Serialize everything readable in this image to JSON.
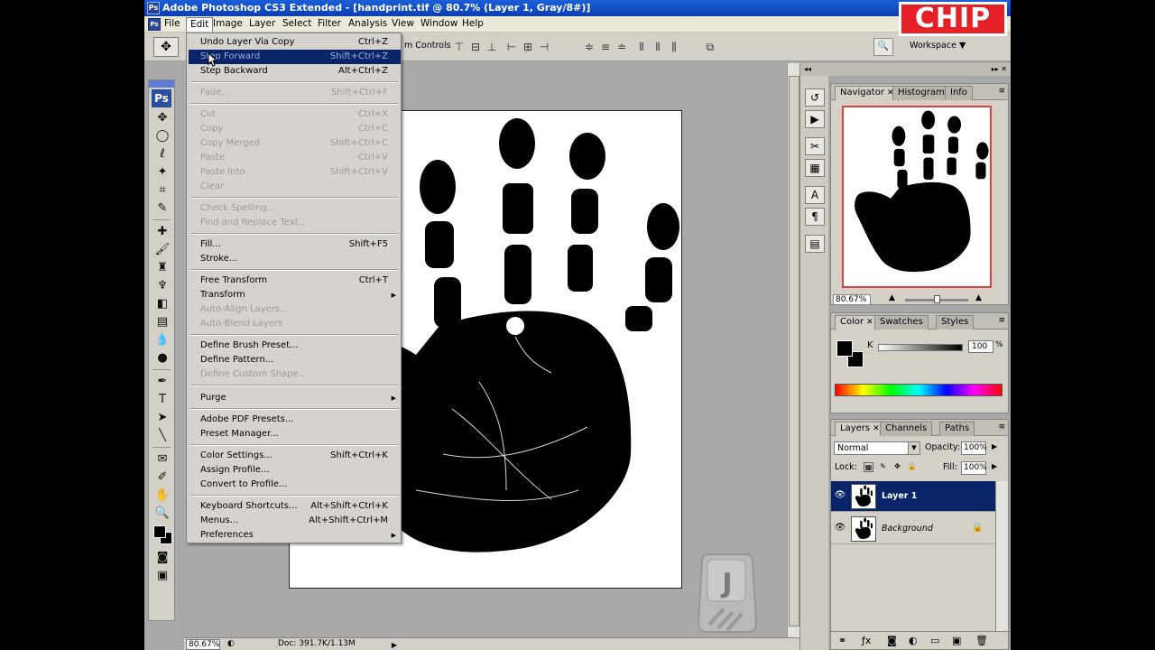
{
  "window": {
    "title": "Adobe Photoshop CS3 Extended - [handprint.tif @ 80.7% (Layer 1, Gray/8#)]",
    "app_icon": "Ps"
  },
  "menubar": {
    "items": [
      "File",
      "Edit",
      "Image",
      "Layer",
      "Select",
      "Filter",
      "Analysis",
      "View",
      "Window",
      "Help"
    ],
    "active": "Edit"
  },
  "options_bar": {
    "transform_label": "m Controls",
    "workspace_label": "Workspace ▼"
  },
  "toolbox": {
    "logo": "Ps"
  },
  "edit_menu": {
    "items": [
      {
        "label": "Undo Layer Via Copy",
        "shortcut": "Ctrl+Z"
      },
      {
        "label": "Step Forward",
        "shortcut": "Shift+Ctrl+Z"
      },
      {
        "label": "Step Backward",
        "shortcut": "Alt+Ctrl+Z"
      },
      {
        "label": "Fade...",
        "shortcut": "Shift+Ctrl+F"
      },
      {
        "label": "Cut",
        "shortcut": "Ctrl+X"
      },
      {
        "label": "Copy",
        "shortcut": "Ctrl+C"
      },
      {
        "label": "Copy Merged",
        "shortcut": "Shift+Ctrl+C"
      },
      {
        "label": "Paste",
        "shortcut": "Ctrl+V"
      },
      {
        "label": "Paste Into",
        "shortcut": "Shift+Ctrl+V"
      },
      {
        "label": "Clear",
        "shortcut": ""
      },
      {
        "label": "Check Spelling...",
        "shortcut": ""
      },
      {
        "label": "Find and Replace Text...",
        "shortcut": ""
      },
      {
        "label": "Fill...",
        "shortcut": "Shift+F5"
      },
      {
        "label": "Stroke...",
        "shortcut": ""
      },
      {
        "label": "Free Transform",
        "shortcut": "Ctrl+T"
      },
      {
        "label": "Transform",
        "shortcut": ""
      },
      {
        "label": "Auto-Align Layers...",
        "shortcut": ""
      },
      {
        "label": "Auto-Blend Layers",
        "shortcut": ""
      },
      {
        "label": "Define Brush Preset...",
        "shortcut": ""
      },
      {
        "label": "Define Pattern...",
        "shortcut": ""
      },
      {
        "label": "Define Custom Shape...",
        "shortcut": ""
      },
      {
        "label": "Purge",
        "shortcut": ""
      },
      {
        "label": "Adobe PDF Presets...",
        "shortcut": ""
      },
      {
        "label": "Preset Manager...",
        "shortcut": ""
      },
      {
        "label": "Color Settings...",
        "shortcut": "Shift+Ctrl+K"
      },
      {
        "label": "Assign Profile...",
        "shortcut": ""
      },
      {
        "label": "Convert to Profile...",
        "shortcut": ""
      },
      {
        "label": "Keyboard Shortcuts...",
        "shortcut": "Alt+Shift+Ctrl+K"
      },
      {
        "label": "Menus...",
        "shortcut": "Alt+Shift+Ctrl+M"
      },
      {
        "label": "Preferences",
        "shortcut": ""
      }
    ]
  },
  "status_bar": {
    "zoom": "80.67%",
    "doc": "Doc: 391.7K/1.13M"
  },
  "navigator": {
    "tabs": [
      "Navigator",
      "Histogram",
      "Info"
    ],
    "zoom": "80.67%"
  },
  "color_panel": {
    "tabs": [
      "Color",
      "Swatches",
      "Styles"
    ],
    "channel": "K",
    "value": "100",
    "unit": "%"
  },
  "layers_panel": {
    "tabs": [
      "Layers",
      "Channels",
      "Paths"
    ],
    "blend_mode": "Normal",
    "opacity_label": "Opacity:",
    "opacity": "100%",
    "lock_label": "Lock:",
    "fill_label": "Fill:",
    "fill": "100%",
    "layers": [
      {
        "name": "Layer 1",
        "selected": true
      },
      {
        "name": "Background",
        "selected": false
      }
    ]
  },
  "overlay": {
    "logo_text": "CHIP",
    "key_letter": "J"
  },
  "colors": {
    "title_blue": "#0a3fb0",
    "selection_navy": "#0a246a",
    "chip_red": "#e41f25"
  }
}
